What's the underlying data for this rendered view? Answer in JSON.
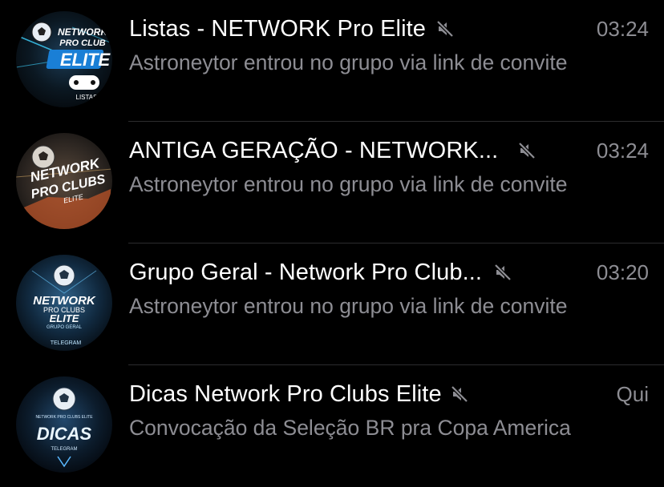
{
  "chats": [
    {
      "title": "Listas - NETWORK Pro Elite",
      "time": "03:24",
      "preview": "Astroneytor entrou no grupo via link de convite",
      "muted": true,
      "avatar": {
        "line1": "NETWORK",
        "line2": "PRO CLUB",
        "line3": "ELITE",
        "line4": "LISTAS"
      }
    },
    {
      "title": "ANTIGA GERAÇÃO - NETWORK...",
      "time": "03:24",
      "preview": "Astroneytor entrou no grupo via link de convite",
      "muted": true,
      "avatar": {
        "line1": "NETWORK",
        "line2": "PRO CLUBS",
        "line3": "ELITE"
      }
    },
    {
      "title": "Grupo Geral - Network Pro Club...",
      "time": "03:20",
      "preview": "Astroneytor entrou no grupo via link de convite",
      "muted": true,
      "avatar": {
        "line1": "NETWORK",
        "line2": "PRO CLUBS",
        "line3": "ELITE",
        "line4": "GRUPO GERAL",
        "line5": "TELEGRAM"
      }
    },
    {
      "title": "Dicas Network Pro Clubs Elite",
      "time": "Qui",
      "preview": "Convocação da Seleção BR pra Copa America",
      "muted": true,
      "avatar": {
        "line1": "NETWORK PRO CLUBS ELITE",
        "line2": "DICAS",
        "line3": "TELEGRAM"
      }
    }
  ],
  "colors": {
    "background": "#000000",
    "title": "#ffffff",
    "secondary": "#8d8d93",
    "separator": "#2c2c2e"
  },
  "icons": {
    "mute": "bell-slash-icon"
  }
}
